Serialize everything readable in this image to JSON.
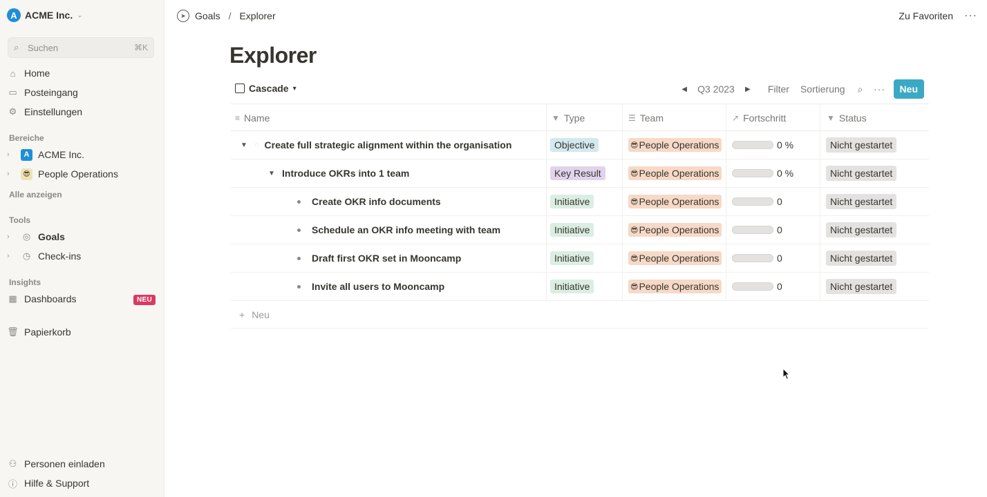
{
  "workspace": {
    "name": "ACME Inc.",
    "logo_letter": "A"
  },
  "search": {
    "placeholder": "Suchen",
    "shortcut": "⌘K"
  },
  "nav": {
    "home": "Home",
    "inbox": "Posteingang",
    "settings": "Einstellungen"
  },
  "areas": {
    "label": "Bereiche",
    "items": [
      {
        "label": "ACME Inc.",
        "icon": "A"
      },
      {
        "label": "People Operations",
        "icon": "😎"
      }
    ],
    "show_all": "Alle anzeigen"
  },
  "tools": {
    "label": "Tools",
    "items": [
      {
        "label": "Goals"
      },
      {
        "label": "Check-ins"
      }
    ]
  },
  "insights": {
    "label": "Insights",
    "dashboards": "Dashboards",
    "badge": "NEU"
  },
  "trash": "Papierkorb",
  "bottom": {
    "invite": "Personen einladen",
    "help": "Hilfe & Support"
  },
  "breadcrumb": {
    "parent": "Goals",
    "separator": "/",
    "current": "Explorer"
  },
  "topbar": {
    "favorite": "Zu Favoriten",
    "more": "···"
  },
  "page": {
    "title": "Explorer"
  },
  "view": {
    "tab": "Cascade",
    "period": "Q3 2023",
    "filter": "Filter",
    "sort": "Sortierung",
    "more": "···",
    "new_button": "Neu"
  },
  "table": {
    "columns": {
      "name": "Name",
      "type": "Type",
      "team": "Team",
      "progress": "Fortschritt",
      "status": "Status"
    },
    "rows": [
      {
        "name": "Create full strategic alignment within the organisation",
        "type": "Objective",
        "team": "People Operations",
        "progress": "0 %",
        "progress_value": 0,
        "status": "Nicht gestartet"
      },
      {
        "name": "Introduce OKRs into 1 team",
        "type": "Key Result",
        "team": "People Operations",
        "progress": "0 %",
        "progress_value": 0,
        "status": "Nicht gestartet"
      },
      {
        "name": "Create OKR info documents",
        "type": "Initiative",
        "team": "People Operations",
        "progress": "0",
        "progress_value": 0,
        "status": "Nicht gestartet"
      },
      {
        "name": "Schedule an OKR info meeting with team",
        "type": "Initiative",
        "team": "People Operations",
        "progress": "0",
        "progress_value": 0,
        "status": "Nicht gestartet"
      },
      {
        "name": "Draft first OKR set in Mooncamp",
        "type": "Initiative",
        "team": "People Operations",
        "progress": "0",
        "progress_value": 0,
        "status": "Nicht gestartet"
      },
      {
        "name": "Invite all users to Mooncamp",
        "type": "Initiative",
        "team": "People Operations",
        "progress": "0",
        "progress_value": 0,
        "status": "Nicht gestartet"
      }
    ],
    "new_row": "Neu"
  },
  "colors": {
    "objective": "#d3e8ef",
    "key_result": "#e1d3ec",
    "initiative": "#dbeee3",
    "team_tag": "#f7d9c7",
    "accent": "#3aa9c3",
    "badge": "#d93a62"
  }
}
